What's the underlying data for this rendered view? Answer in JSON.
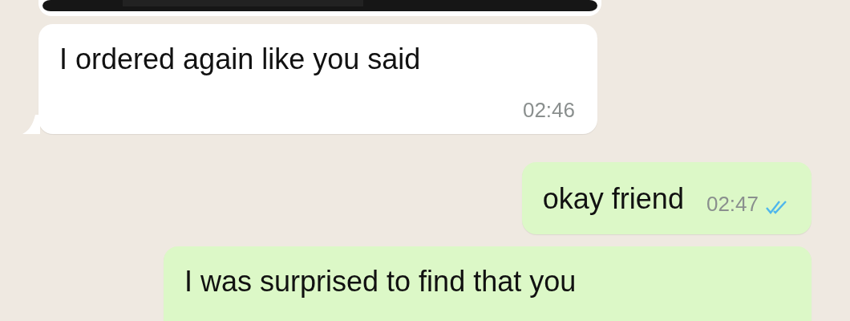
{
  "messages": [
    {
      "kind": "media",
      "outgoing": false
    },
    {
      "kind": "text",
      "outgoing": false,
      "text": "I ordered again like you said",
      "time": "02:46"
    },
    {
      "kind": "short",
      "outgoing": true,
      "text": "okay friend",
      "time": "02:47",
      "read": true
    },
    {
      "kind": "text",
      "outgoing": true,
      "text": "I was surprised to find that you"
    }
  ]
}
